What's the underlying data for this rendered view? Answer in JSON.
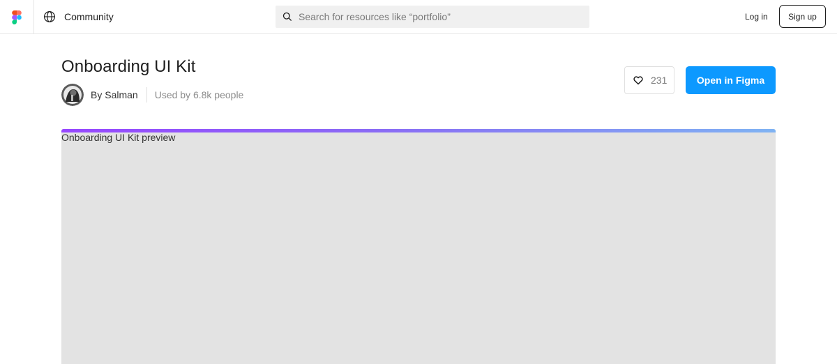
{
  "header": {
    "community_label": "Community",
    "search": {
      "placeholder": "Search for resources like “portfolio”",
      "value": ""
    },
    "login_label": "Log in",
    "signup_label": "Sign up",
    "icons": {
      "logo": "figma-logo-icon",
      "community": "globe-icon",
      "search": "search-icon"
    }
  },
  "resource": {
    "title": "Onboarding UI Kit",
    "author_label": "By Salman",
    "usage_label": "Used by 6.8k people",
    "like_count": "231",
    "open_label": "Open in Figma",
    "icons": {
      "like": "heart-icon",
      "avatar": "avatar-image"
    }
  },
  "preview": {
    "alt_text": "Onboarding UI Kit preview"
  },
  "colors": {
    "accent": "#0d99ff",
    "text": "#1e1e1e",
    "muted": "#8c8c8c",
    "preview_bg": "#e3e3e3",
    "gradient_start": "#9747ff",
    "gradient_end": "#7fb3f3"
  }
}
